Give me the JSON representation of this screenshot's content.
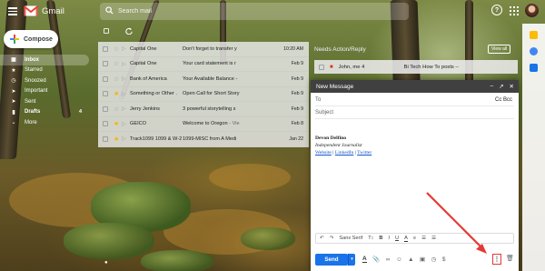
{
  "brand": {
    "name": "Gmail"
  },
  "search": {
    "placeholder": "Search mail"
  },
  "top_right": {
    "help": "?"
  },
  "compose_button": {
    "label": "Compose"
  },
  "sidebar": {
    "items": [
      {
        "label": "Inbox",
        "icon": "inbox-icon",
        "active": true
      },
      {
        "label": "Starred",
        "icon": "star-icon"
      },
      {
        "label": "Snoozed",
        "icon": "clock-icon"
      },
      {
        "label": "Important",
        "icon": "important-icon"
      },
      {
        "label": "Sent",
        "icon": "send-icon"
      },
      {
        "label": "Drafts",
        "icon": "draft-icon",
        "count": "4"
      },
      {
        "label": "More",
        "icon": "chevron-down-icon"
      }
    ]
  },
  "messages": [
    {
      "sender": "Capital One",
      "subject": "Don't forget to transfer y",
      "date": "10:20 AM",
      "starred": false
    },
    {
      "sender": "Capital One",
      "subject": "Your card statement is r",
      "date": "Feb 9",
      "starred": false
    },
    {
      "sender": "Bank of America",
      "subject": "Your Available Balance - ",
      "date": "Feb 9",
      "starred": false
    },
    {
      "sender": "Something or Other .",
      "subject": "Open Call for Short Story",
      "date": "Feb 9",
      "starred": true
    },
    {
      "sender": "Jerry Jenkins",
      "subject": "3 powerful storytelling s",
      "date": "Feb 9",
      "starred": false
    },
    {
      "sender": "GEICO",
      "subject": "Welcome to Oregon",
      "subject_rest": " - Vie",
      "date": "Feb 8",
      "starred": true
    },
    {
      "sender": "Track1099 1099 & W-2",
      "subject": "1099-MISC from A Medi",
      "date": "Jan 22",
      "starred": true
    }
  ],
  "needs_action": {
    "header": "Needs Action/Reply",
    "view_all": "View all",
    "rows": [
      {
        "sender": "John, me 4",
        "subject": "Bi Tech How To posts –"
      }
    ]
  },
  "compose_window": {
    "title": "New Message",
    "to_label": "To",
    "cc_bcc": "Cc Bcc",
    "subject_label": "Subject",
    "signature": {
      "name": "Devon Delfino",
      "role": "Independent Journalist",
      "links": [
        "Website",
        "LinkedIn",
        "Twitter"
      ],
      "separator": " | "
    },
    "format_bar": {
      "undo": "↶",
      "redo": "↷",
      "font": "Sans Serif",
      "size": "ᴛᴛ",
      "bold": "B",
      "italic": "I",
      "underline": "U",
      "text_color": "A",
      "align": "≡",
      "numbered_list": "☰",
      "bulleted_list": "☰"
    },
    "send_label": "Send",
    "more_options": "⋮"
  },
  "colors": {
    "accent": "#1a73e8",
    "highlight": "#e53935",
    "star": "#f4b400"
  }
}
